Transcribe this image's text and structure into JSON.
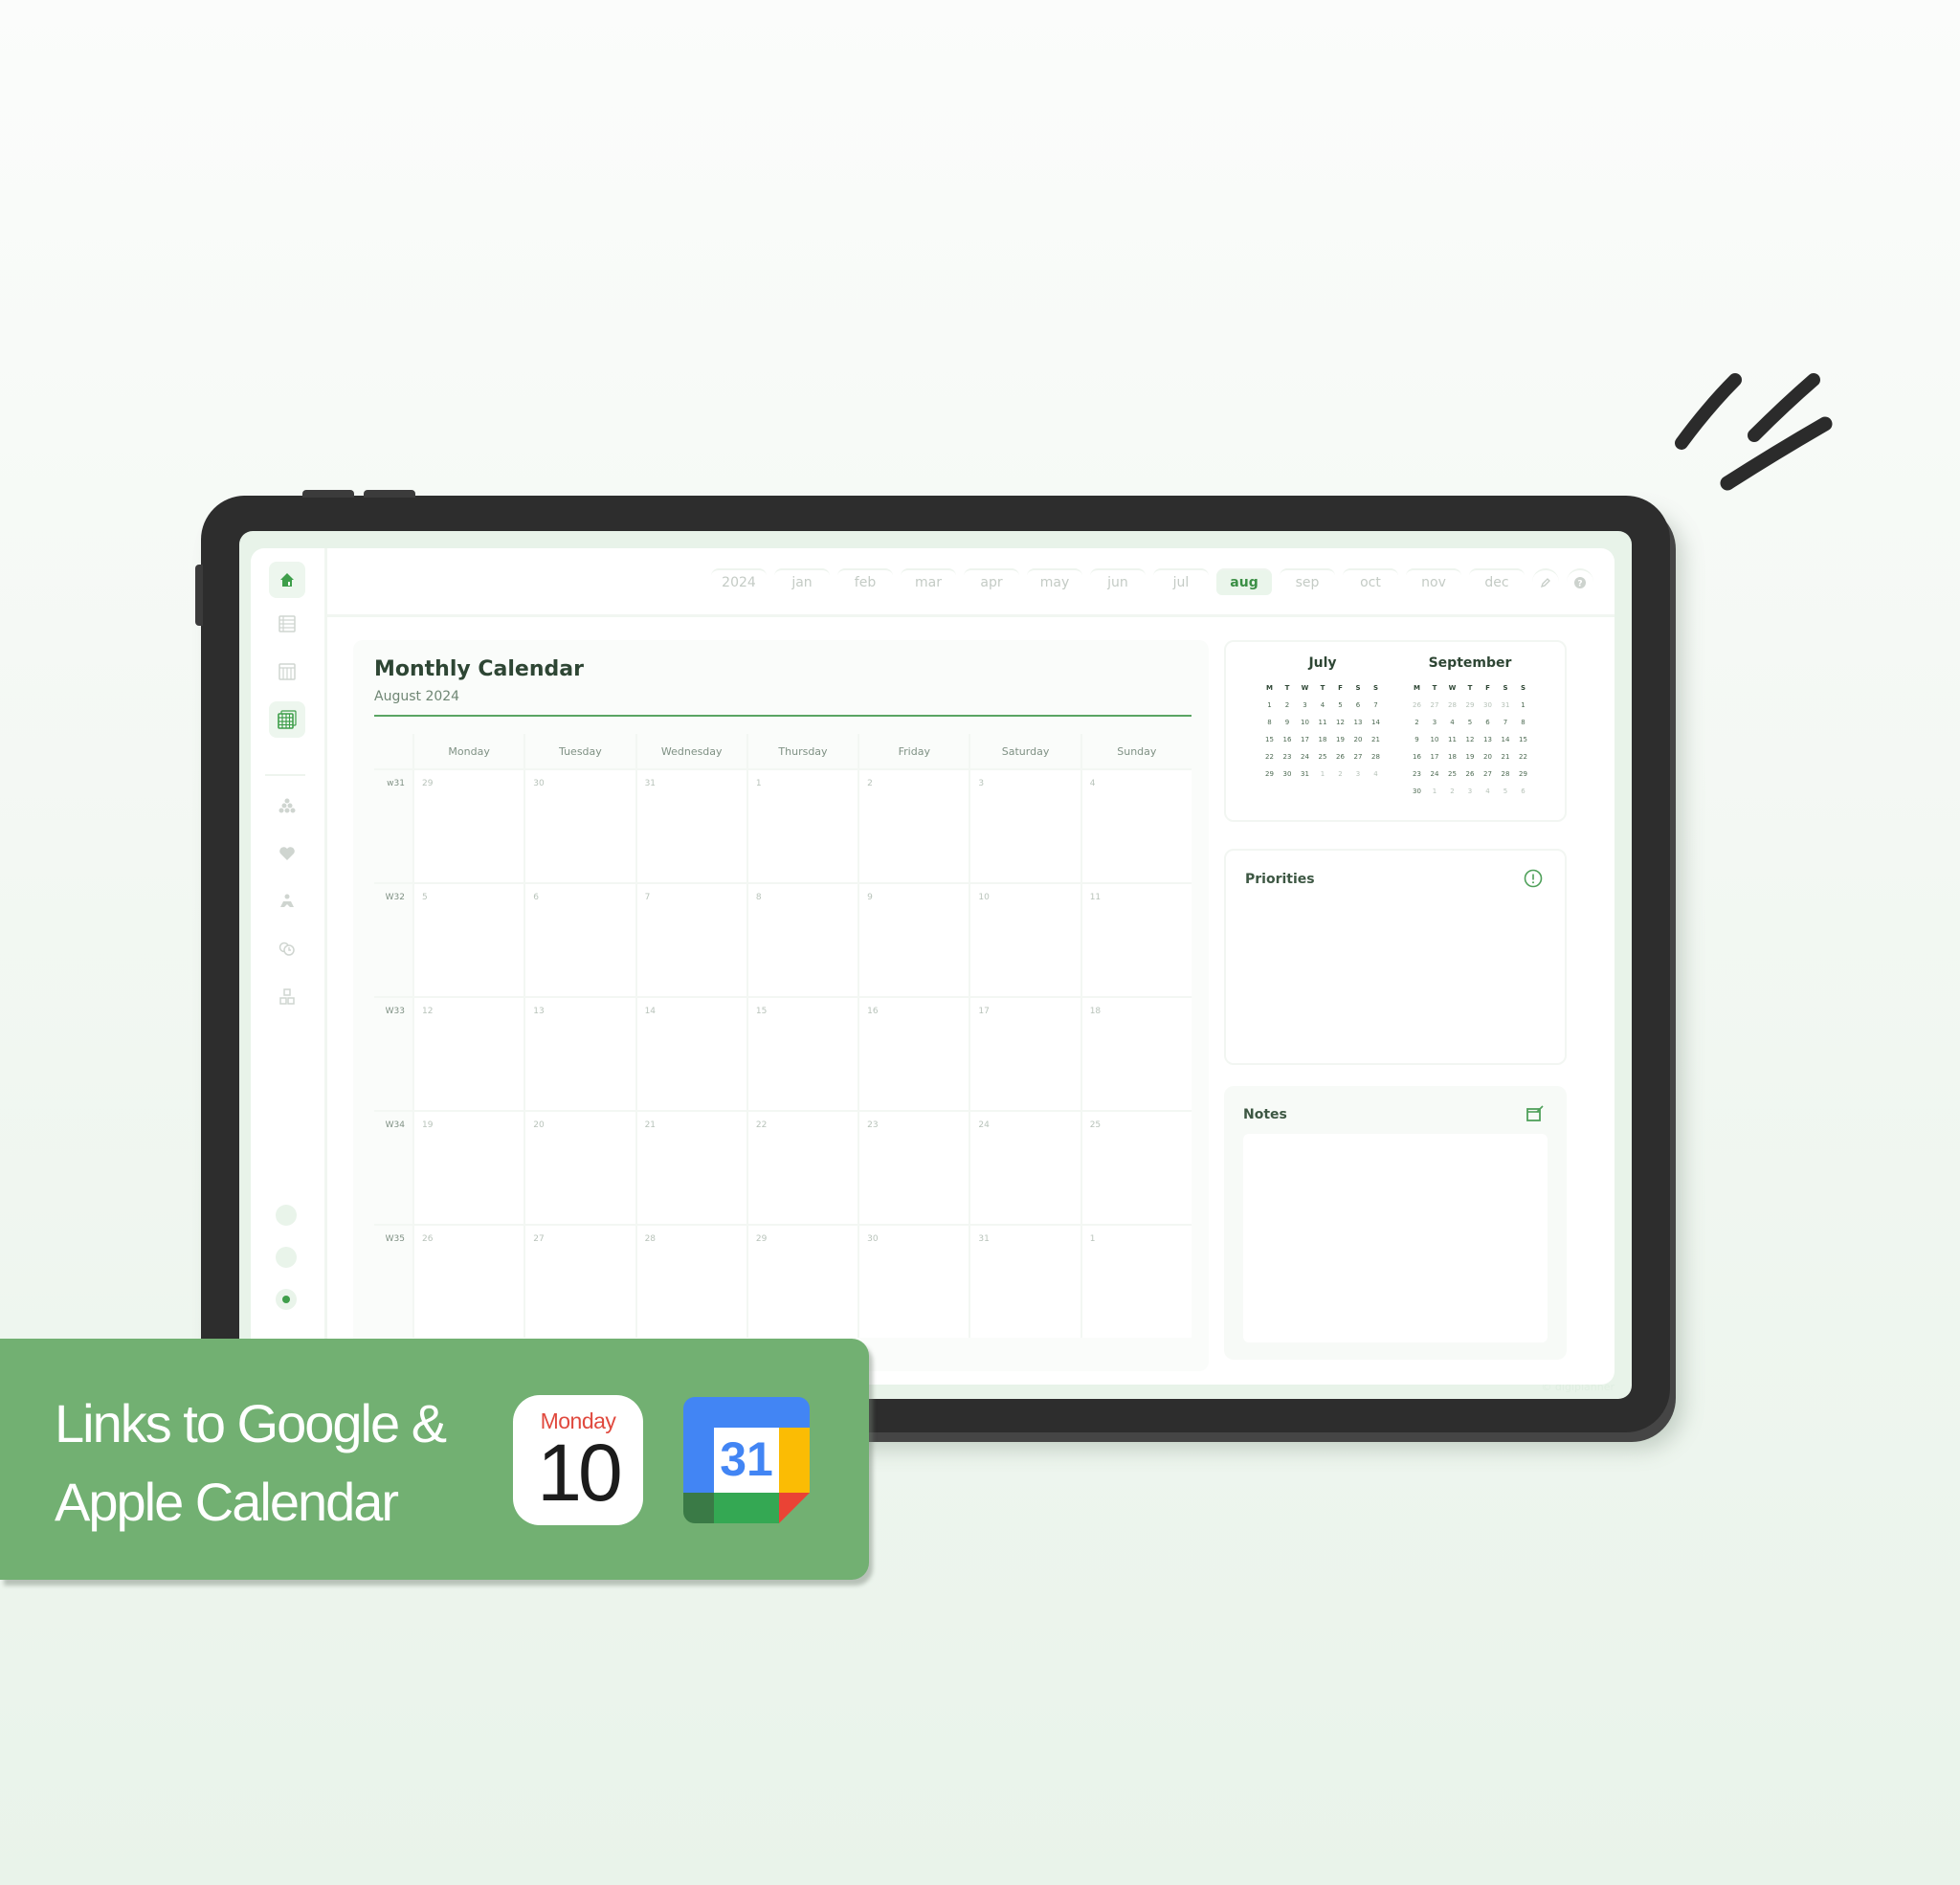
{
  "nav": {
    "year": "2024",
    "months": [
      "jan",
      "feb",
      "mar",
      "apr",
      "may",
      "jun",
      "jul",
      "aug",
      "sep",
      "oct",
      "nov",
      "dec"
    ],
    "active_month": "aug",
    "edit_icon": "pencil-icon",
    "help_icon": "help-icon"
  },
  "sidebar": {
    "items": [
      {
        "name": "home",
        "icon": "home-icon",
        "active": true
      },
      {
        "name": "yearly",
        "icon": "list-grid-icon",
        "active": false
      },
      {
        "name": "weekly",
        "icon": "columns-grid-icon",
        "active": false
      },
      {
        "name": "monthly",
        "icon": "calendar-grid-icon",
        "active": true
      },
      {
        "name": "goals",
        "icon": "pyramid-icon",
        "active": false
      },
      {
        "name": "health",
        "icon": "heart-icon",
        "active": false
      },
      {
        "name": "self-care",
        "icon": "person-icon",
        "active": false
      },
      {
        "name": "routines",
        "icon": "clock-icon",
        "active": false
      },
      {
        "name": "projects",
        "icon": "blocks-icon",
        "active": false
      }
    ],
    "dots": [
      false,
      false,
      true
    ]
  },
  "calendar": {
    "title": "Monthly Calendar",
    "subtitle": "August 2024",
    "weekdays": [
      "Monday",
      "Tuesday",
      "Wednesday",
      "Thursday",
      "Friday",
      "Saturday",
      "Sunday"
    ],
    "weeks": [
      {
        "label": "w31",
        "days": [
          "29",
          "30",
          "31",
          "1",
          "2",
          "3",
          "4"
        ]
      },
      {
        "label": "W32",
        "days": [
          "5",
          "6",
          "7",
          "8",
          "9",
          "10",
          "11"
        ]
      },
      {
        "label": "W33",
        "days": [
          "12",
          "13",
          "14",
          "15",
          "16",
          "17",
          "18"
        ]
      },
      {
        "label": "W34",
        "days": [
          "19",
          "20",
          "21",
          "22",
          "23",
          "24",
          "25"
        ]
      },
      {
        "label": "W35",
        "days": [
          "26",
          "27",
          "28",
          "29",
          "30",
          "31",
          "1"
        ]
      }
    ]
  },
  "mini_calendars": [
    {
      "title": "July",
      "headers": [
        "M",
        "T",
        "W",
        "T",
        "F",
        "S",
        "S"
      ],
      "days": [
        "1",
        "2",
        "3",
        "4",
        "5",
        "6",
        "7",
        "8",
        "9",
        "10",
        "11",
        "12",
        "13",
        "14",
        "15",
        "16",
        "17",
        "18",
        "19",
        "20",
        "21",
        "22",
        "23",
        "24",
        "25",
        "26",
        "27",
        "28",
        "29",
        "30",
        "31",
        "1",
        "2",
        "3",
        "4"
      ],
      "outside": [
        false,
        false,
        false,
        false,
        false,
        false,
        false,
        false,
        false,
        false,
        false,
        false,
        false,
        false,
        false,
        false,
        false,
        false,
        false,
        false,
        false,
        false,
        false,
        false,
        false,
        false,
        false,
        false,
        false,
        false,
        false,
        true,
        true,
        true,
        true
      ]
    },
    {
      "title": "September",
      "headers": [
        "M",
        "T",
        "W",
        "T",
        "F",
        "S",
        "S"
      ],
      "days": [
        "26",
        "27",
        "28",
        "29",
        "30",
        "31",
        "1",
        "2",
        "3",
        "4",
        "5",
        "6",
        "7",
        "8",
        "9",
        "10",
        "11",
        "12",
        "13",
        "14",
        "15",
        "16",
        "17",
        "18",
        "19",
        "20",
        "21",
        "22",
        "23",
        "24",
        "25",
        "26",
        "27",
        "28",
        "29",
        "30",
        "1",
        "2",
        "3",
        "4",
        "5",
        "6"
      ],
      "outside": [
        true,
        true,
        true,
        true,
        true,
        true,
        false,
        false,
        false,
        false,
        false,
        false,
        false,
        false,
        false,
        false,
        false,
        false,
        false,
        false,
        false,
        false,
        false,
        false,
        false,
        false,
        false,
        false,
        false,
        false,
        false,
        false,
        false,
        false,
        false,
        false,
        true,
        true,
        true,
        true,
        true,
        true
      ]
    }
  ],
  "panels": {
    "priorities": {
      "title": "Priorities",
      "icon": "alert-circle-icon"
    },
    "notes": {
      "title": "Notes",
      "icon": "edit-note-icon"
    }
  },
  "watermark": "© digiplanner",
  "banner": {
    "line1": "Links to Google &",
    "line2": "Apple Calendar",
    "apple_icon": {
      "day": "Monday",
      "date": "10"
    },
    "google_icon": {
      "date": "31"
    }
  },
  "colors": {
    "accent": "#3e9e4a",
    "banner": "#72b072",
    "bezel": "#2d2d2d",
    "title_text": "#2e4634"
  }
}
